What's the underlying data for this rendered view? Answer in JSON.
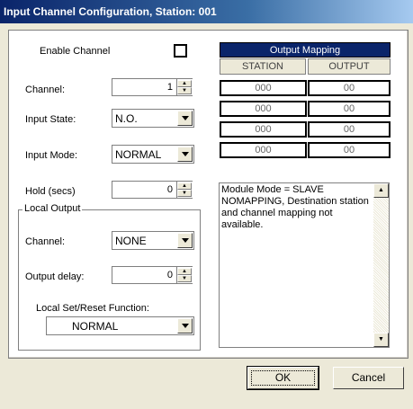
{
  "window": {
    "title": "Input Channel Configuration, Station: 001"
  },
  "enable_channel": {
    "label": "Enable Channel",
    "checked": false
  },
  "channel": {
    "label": "Channel:",
    "value": "1"
  },
  "input_state": {
    "label": "Input State:",
    "value": "N.O."
  },
  "input_mode": {
    "label": "Input Mode:",
    "value": "NORMAL"
  },
  "hold": {
    "label": "Hold (secs)",
    "value": "0"
  },
  "local_output": {
    "title": "Local Output",
    "channel_label": "Channel:",
    "channel_value": "NONE",
    "delay_label": "Output delay:",
    "delay_value": "0",
    "function_label": "Local Set/Reset Function:",
    "function_value": "NORMAL"
  },
  "output_mapping": {
    "title": "Output Mapping",
    "col_station": "STATION",
    "col_output": "OUTPUT",
    "rows": [
      {
        "station": "000",
        "output": "00"
      },
      {
        "station": "000",
        "output": "00"
      },
      {
        "station": "000",
        "output": "00"
      },
      {
        "station": "000",
        "output": "00"
      }
    ]
  },
  "message": "Module Mode = SLAVE NOMAPPING, Destination station and channel mapping not available.",
  "buttons": {
    "ok": "OK",
    "cancel": "Cancel"
  },
  "colors": {
    "title_bar": "#0a246a",
    "face": "#ece9d8"
  }
}
